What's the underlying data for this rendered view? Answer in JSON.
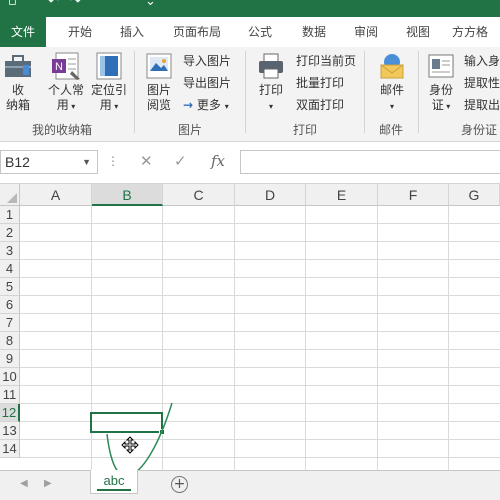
{
  "tabs": [
    "文件",
    "开始",
    "插入",
    "页面布局",
    "公式",
    "数据",
    "审阅",
    "视图",
    "方方格"
  ],
  "ribbon": {
    "group1": {
      "buttons": [
        {
          "line1": "收",
          "line2": "纳箱",
          "icon": "toolbox-icon"
        },
        {
          "line1": "个人常",
          "line2": "用",
          "icon": "personal-notebook-icon"
        },
        {
          "line1": "定位引",
          "line2": "用",
          "icon": "locate-reference-icon"
        }
      ],
      "label": "我的收纳箱"
    },
    "group2": {
      "big_button": {
        "line1": "图片",
        "line2": "阅览",
        "icon": "image-viewer-icon"
      },
      "small_buttons": [
        "导入图片",
        "导出图片",
        "更多"
      ],
      "label": "图片"
    },
    "group3": {
      "big_button": {
        "label": "打印",
        "icon": "printer-icon"
      },
      "small_buttons": [
        "打印当前页",
        "批量打印",
        "双面打印"
      ],
      "label": "打印"
    },
    "group4": {
      "big_button": {
        "label": "邮件",
        "icon": "mail-icon"
      },
      "label": "邮件"
    },
    "group5": {
      "big_button": {
        "line1": "身份",
        "line2": "证",
        "icon": "id-card-icon"
      },
      "small_buttons": [
        "输入身",
        "提取性",
        "提取出"
      ],
      "label": "身份证"
    }
  },
  "formula_bar": {
    "name_box": "B12",
    "cancel": "✕",
    "enter": "✓",
    "fx": "fx",
    "formula": ""
  },
  "grid": {
    "columns": [
      "A",
      "B",
      "C",
      "D",
      "E",
      "F",
      "G"
    ],
    "rows": [
      "1",
      "2",
      "3",
      "4",
      "5",
      "6",
      "7",
      "8",
      "9",
      "10",
      "11",
      "12",
      "13",
      "14"
    ],
    "selected_column": "B",
    "selected_row": "12"
  },
  "sheets": {
    "active": "abc",
    "add_label": "+"
  },
  "colors": {
    "accent": "#217346",
    "ribbon_bg": "#f3f3f3",
    "gesture_stroke": "#2e8b57"
  }
}
